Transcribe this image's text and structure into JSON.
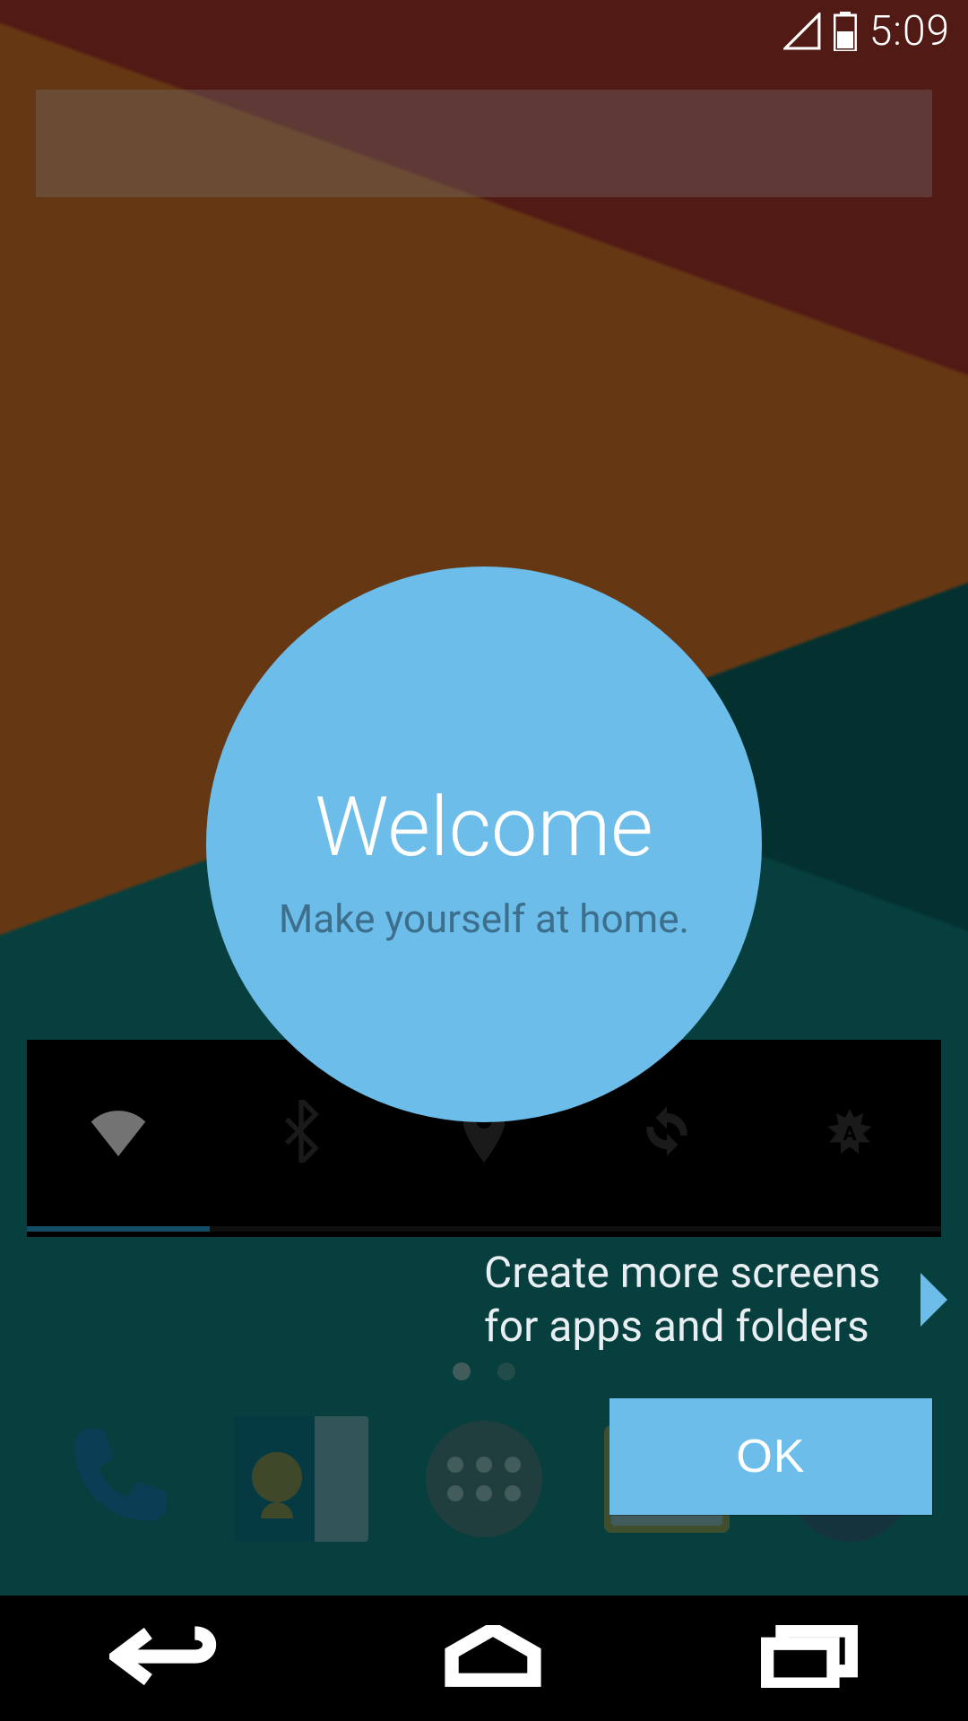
{
  "statusbar": {
    "time": "5:09"
  },
  "overlay": {
    "title": "Welcome",
    "subtitle": "Make yourself at home.",
    "hint": "Create more screens for apps and folders",
    "ok_label": "OK"
  },
  "colors": {
    "accent": "#6cbde9"
  }
}
